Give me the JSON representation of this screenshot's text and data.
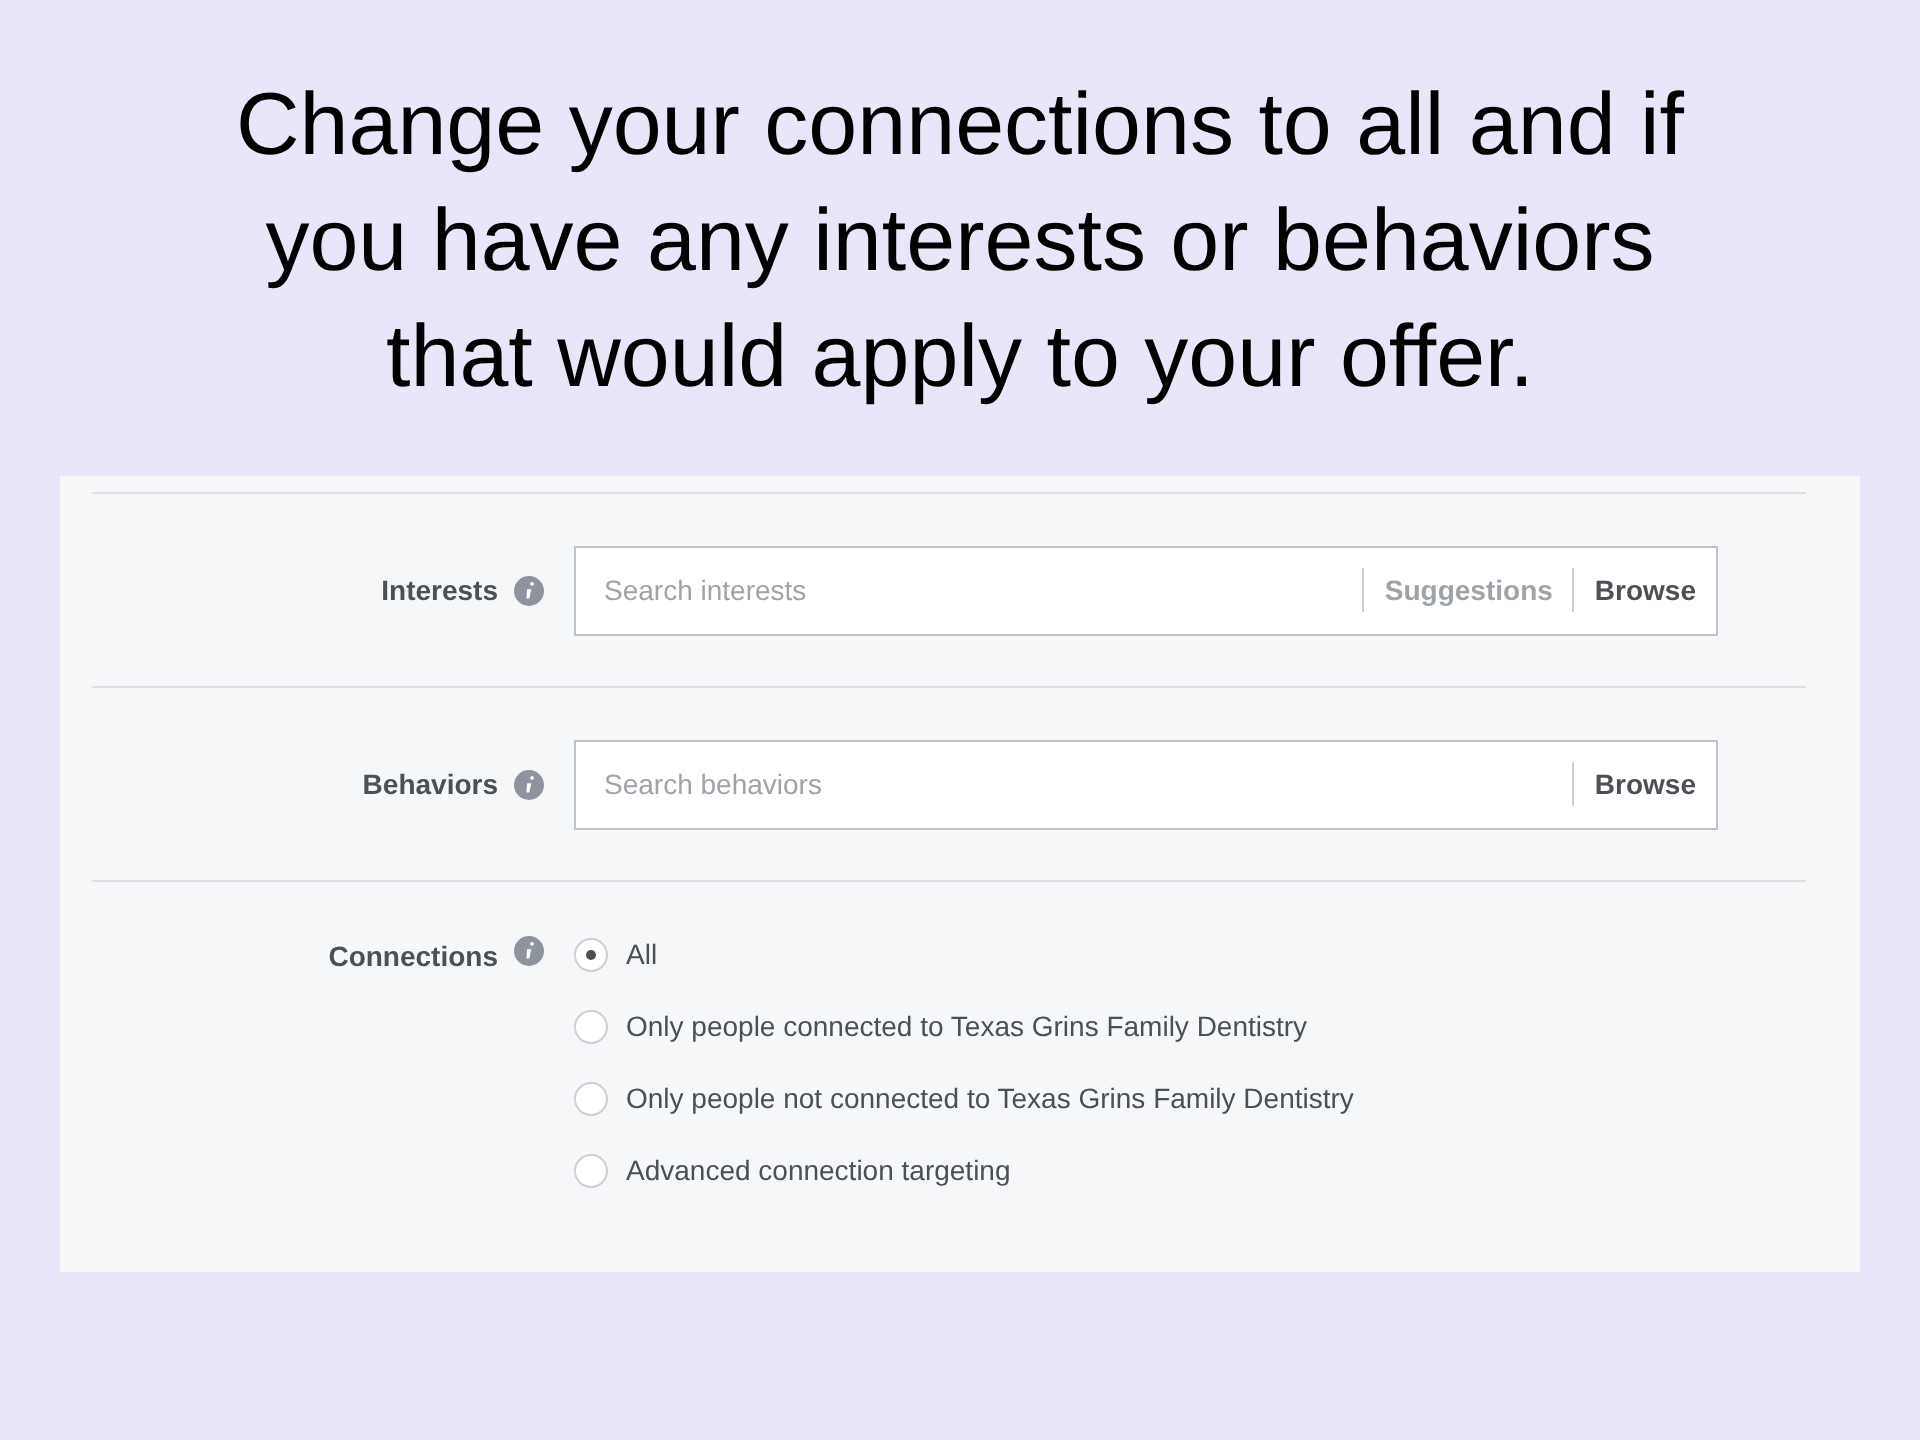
{
  "slide": {
    "title": "Change your connections to all and if you have any interests or behaviors that would apply to your offer."
  },
  "fields": [
    {
      "label": "Interests",
      "placeholder": "Search interests",
      "actions": [
        {
          "label": "Suggestions",
          "disabled": true
        },
        {
          "label": "Browse",
          "disabled": false
        }
      ]
    },
    {
      "label": "Behaviors",
      "placeholder": "Search behaviors",
      "actions": [
        {
          "label": "Browse",
          "disabled": false
        }
      ]
    }
  ],
  "connections": {
    "label": "Connections",
    "options": [
      {
        "label": "All",
        "selected": true
      },
      {
        "label": "Only people connected to Texas Grins Family Dentistry",
        "selected": false
      },
      {
        "label": "Only people not connected to Texas Grins Family Dentistry",
        "selected": false
      },
      {
        "label": "Advanced connection targeting",
        "selected": false
      }
    ]
  }
}
